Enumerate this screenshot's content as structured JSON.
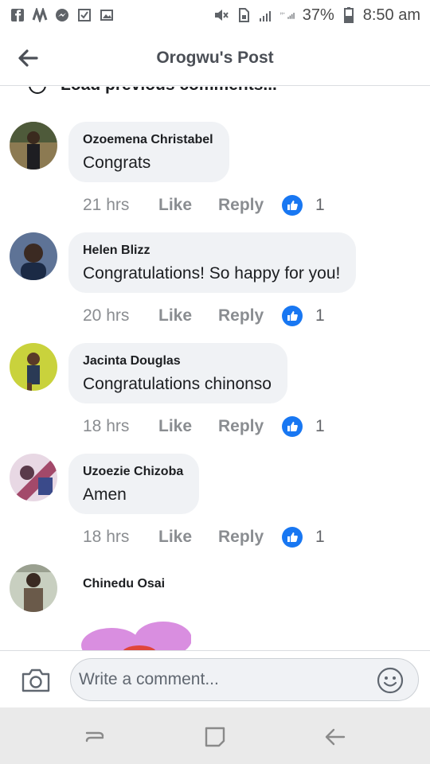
{
  "status_bar": {
    "battery_percent": "37%",
    "time": "8:50 am"
  },
  "header": {
    "title": "Orogwu's Post"
  },
  "load_previous": "Load previous comments...",
  "comments": [
    {
      "author": "Ozoemena Christabel",
      "text": "Congrats",
      "time": "21 hrs",
      "like_label": "Like",
      "reply_label": "Reply",
      "reaction_count": "1",
      "avatar_color": "#7a6a4a"
    },
    {
      "author": "Helen Blizz",
      "text": "Congratulations! So happy for you!",
      "time": "20 hrs",
      "like_label": "Like",
      "reply_label": "Reply",
      "reaction_count": "1",
      "avatar_color": "#4a5d7a"
    },
    {
      "author": "Jacinta Douglas",
      "text": "Congratulations chinonso",
      "time": "18 hrs",
      "like_label": "Like",
      "reply_label": "Reply",
      "reaction_count": "1",
      "avatar_color": "#c7d33a"
    },
    {
      "author": "Uzoezie Chizoba",
      "text": "Amen",
      "time": "18 hrs",
      "like_label": "Like",
      "reply_label": "Reply",
      "reaction_count": "1",
      "avatar_color": "#a36a8a"
    }
  ],
  "last_comment": {
    "author": "Chinedu Osai",
    "sticker": "flower-sticker"
  },
  "composer": {
    "placeholder": "Write a comment...",
    "camera_icon": "camera-icon",
    "emoji_icon": "emoji-icon"
  },
  "colors": {
    "reaction_blue": "#1877f2",
    "bubble_bg": "#f0f2f5",
    "meta_gray": "#8a8d91",
    "sticker_pink": "#d98ee0"
  }
}
